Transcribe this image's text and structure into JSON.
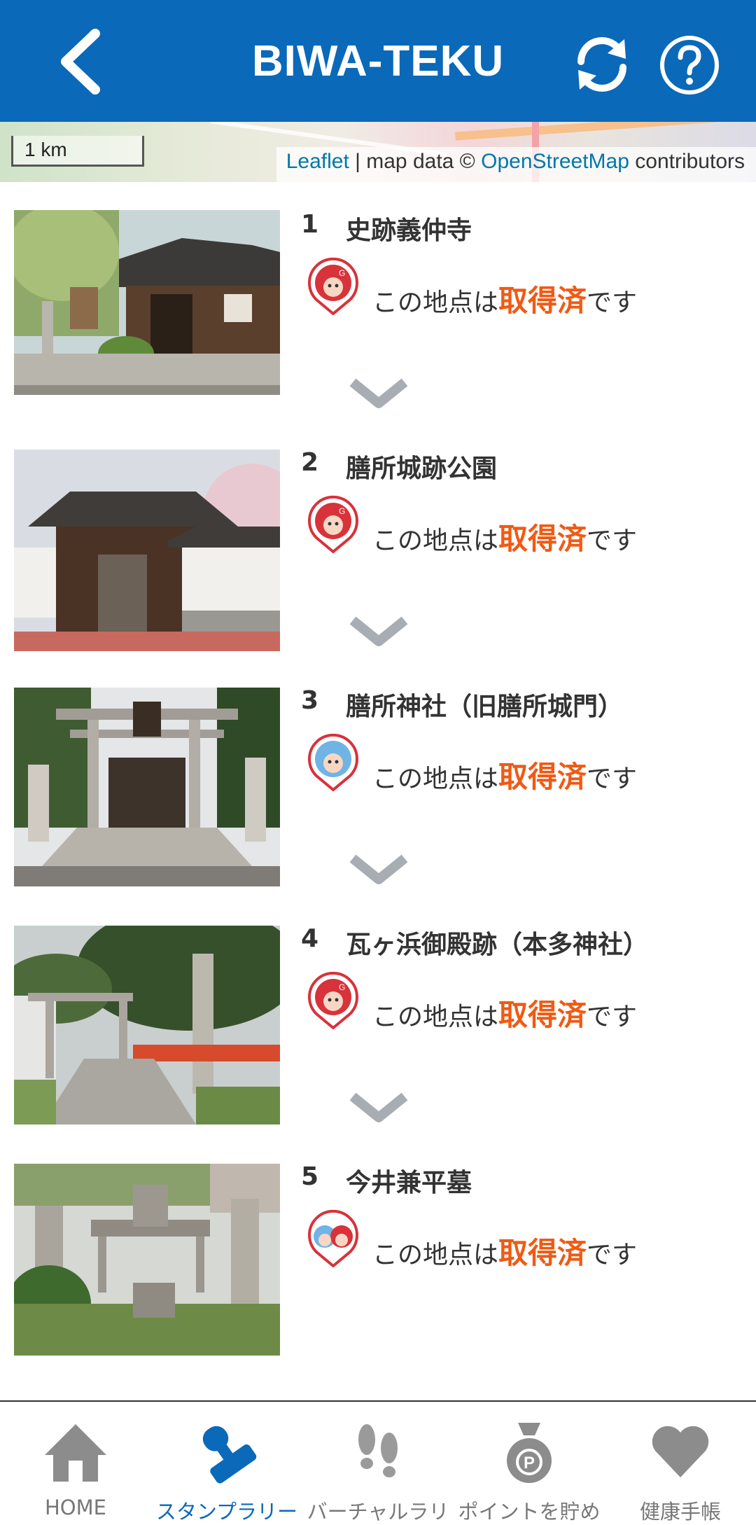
{
  "header": {
    "title": "BIWA-TEKU",
    "back_icon": "chevron-left-icon",
    "refresh_icon": "refresh-icon",
    "help_icon": "help-circle-icon",
    "background": "#0a69b9"
  },
  "map": {
    "scale_label": "1 km",
    "attribution": {
      "leaflet": "Leaflet",
      "separator": " | map data © ",
      "osm": "OpenStreetMap",
      "suffix": " contributors"
    }
  },
  "spots": [
    {
      "number": "1",
      "name": "史跡義仲寺",
      "status_pre": "この地点は",
      "status_hl": "取得済",
      "status_post": "です",
      "stamp": "red-character"
    },
    {
      "number": "2",
      "name": "膳所城跡公園",
      "status_pre": "この地点は",
      "status_hl": "取得済",
      "status_post": "です",
      "stamp": "red-character"
    },
    {
      "number": "3",
      "name": "膳所神社（旧膳所城門）",
      "status_pre": "この地点は",
      "status_hl": "取得済",
      "status_post": "です",
      "stamp": "blue-character"
    },
    {
      "number": "4",
      "name": "瓦ヶ浜御殿跡（本多神社）",
      "status_pre": "この地点は",
      "status_hl": "取得済",
      "status_post": "です",
      "stamp": "red-character"
    },
    {
      "number": "5",
      "name": "今井兼平墓",
      "status_pre": "この地点は",
      "status_hl": "取得済",
      "status_post": "です",
      "stamp": "pair-characters"
    }
  ],
  "colors": {
    "accent": "#0a69b9",
    "highlight": "#f05a13",
    "inactive": "#777777"
  },
  "bottom_nav": [
    {
      "label": "HOME",
      "icon": "home-icon",
      "active": false
    },
    {
      "label": "スタンプラリー",
      "icon": "stamp-icon",
      "active": true
    },
    {
      "label": "バーチャルラリ",
      "icon": "footprints-icon",
      "active": false
    },
    {
      "label": "ポイントを貯め",
      "icon": "point-bag-icon",
      "active": false
    },
    {
      "label": "健康手帳",
      "icon": "heart-icon",
      "active": false
    }
  ]
}
